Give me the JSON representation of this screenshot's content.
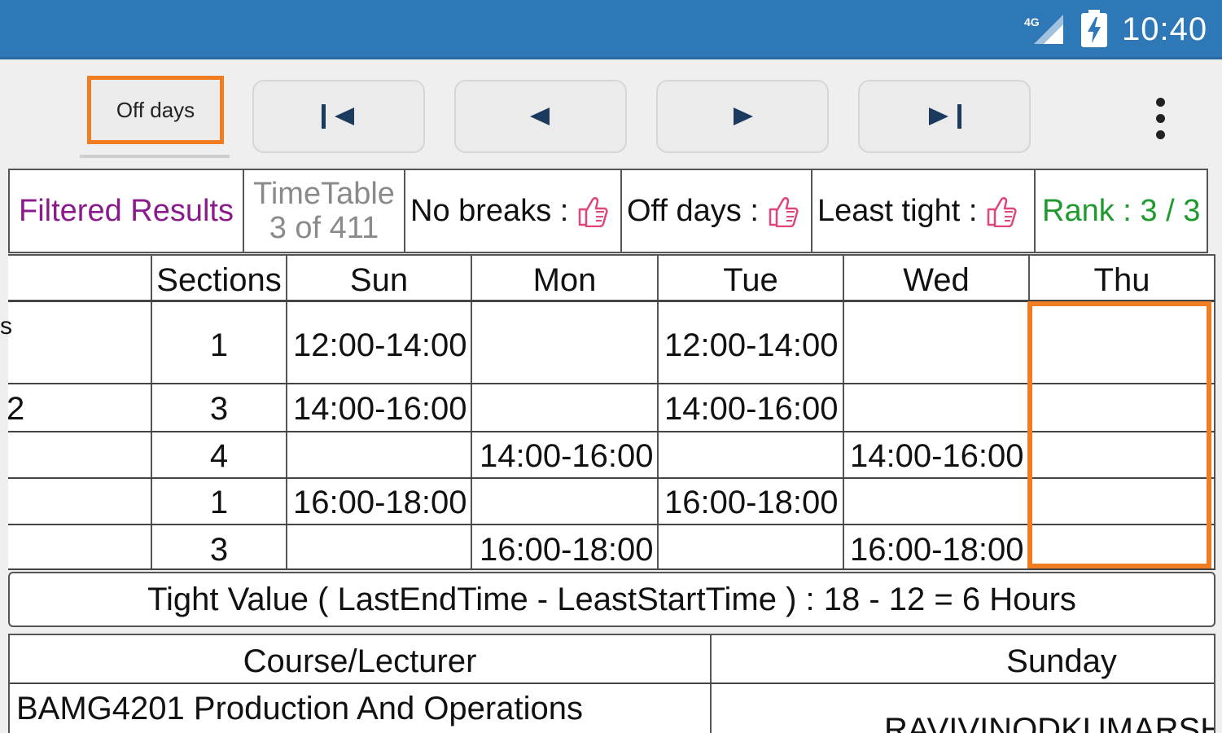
{
  "status_bar": {
    "network": "4G",
    "time": "10:40"
  },
  "toolbar": {
    "off_days_label": "Off days",
    "first_icon": "skip-to-first-icon",
    "prev_icon": "previous-icon",
    "next_icon": "next-icon",
    "last_icon": "skip-to-last-icon",
    "menu_icon": "more-vertical-icon"
  },
  "info": {
    "filtered_results": "Filtered Results",
    "timetable_label": "TimeTable",
    "timetable_count": "3 of 411",
    "no_breaks": "No breaks :",
    "off_days": "Off days :",
    "least_tight": "Least tight :",
    "rank": "Rank : 3 / 3",
    "thumb_icon": "thumbs-up-icon"
  },
  "timetable": {
    "headers": [
      "",
      "Sections",
      "Sun",
      "Mon",
      "Tue",
      "Wed",
      "Thu"
    ],
    "rows": [
      {
        "course": "s",
        "section": "1",
        "sun": "12:00-14:00",
        "mon": "",
        "tue": "12:00-14:00",
        "wed": "",
        "thu": ""
      },
      {
        "course": "2",
        "section": "3",
        "sun": "14:00-16:00",
        "mon": "",
        "tue": "14:00-16:00",
        "wed": "",
        "thu": ""
      },
      {
        "course": "",
        "section": "4",
        "sun": "",
        "mon": "14:00-16:00",
        "tue": "",
        "wed": "14:00-16:00",
        "thu": ""
      },
      {
        "course": "",
        "section": "1",
        "sun": "16:00-18:00",
        "mon": "",
        "tue": "16:00-18:00",
        "wed": "",
        "thu": ""
      },
      {
        "course": "",
        "section": "3",
        "sun": "",
        "mon": "16:00-18:00",
        "tue": "",
        "wed": "16:00-18:00",
        "thu": ""
      }
    ]
  },
  "tight_value": "Tight Value ( LastEndTime - LeastStartTime ) : 18 - 12 = 6 Hours",
  "course_table": {
    "headers": [
      "Course/Lecturer",
      "Sunday"
    ],
    "row1_course": "BAMG4201 Production And Operations",
    "row1_sunday": "RAVIVINODKUMARSHAR"
  },
  "colors": {
    "status_bar": "#2f78b8",
    "highlight": "#f07d22",
    "filtered_results": "#8a1b8c",
    "timetable_label": "#8a8a8a",
    "rank": "#1f9a2e",
    "thumb": "#e0457b",
    "nav_icon": "#1c3a5e"
  }
}
